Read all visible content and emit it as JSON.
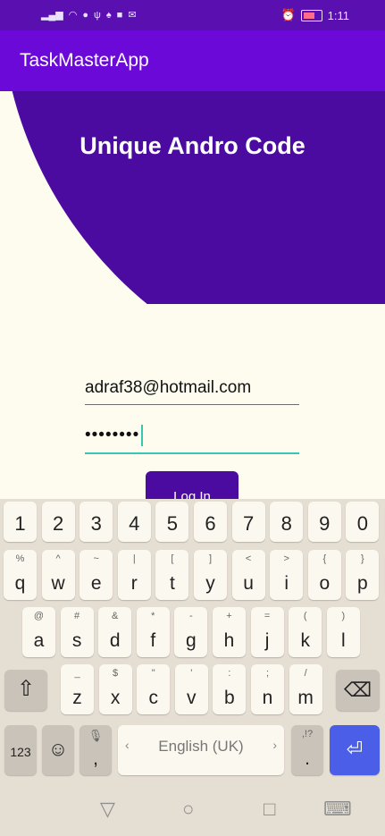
{
  "status": {
    "left_icons": [
      "signal-icon",
      "wifi-icon",
      "notification-icon",
      "usb-icon",
      "snapchat-icon",
      "app-icon",
      "mail-icon"
    ],
    "time": "1:11"
  },
  "app_bar": {
    "title": "TaskMasterApp"
  },
  "header": {
    "title": "Unique Andro Code"
  },
  "form": {
    "email": "adraf38@hotmail.com",
    "password_mask": "••••••••",
    "login_label": "Log In"
  },
  "keyboard": {
    "numbers": [
      "1",
      "2",
      "3",
      "4",
      "5",
      "6",
      "7",
      "8",
      "9",
      "0"
    ],
    "row1": [
      {
        "main": "q",
        "hint": "%"
      },
      {
        "main": "w",
        "hint": "^"
      },
      {
        "main": "e",
        "hint": "~"
      },
      {
        "main": "r",
        "hint": "|"
      },
      {
        "main": "t",
        "hint": "["
      },
      {
        "main": "y",
        "hint": "]"
      },
      {
        "main": "u",
        "hint": "<"
      },
      {
        "main": "i",
        "hint": ">"
      },
      {
        "main": "o",
        "hint": "{"
      },
      {
        "main": "p",
        "hint": "}"
      }
    ],
    "row2": [
      {
        "main": "a",
        "hint": "@"
      },
      {
        "main": "s",
        "hint": "#"
      },
      {
        "main": "d",
        "hint": "&"
      },
      {
        "main": "f",
        "hint": "*"
      },
      {
        "main": "g",
        "hint": "-"
      },
      {
        "main": "h",
        "hint": "+"
      },
      {
        "main": "j",
        "hint": "="
      },
      {
        "main": "k",
        "hint": "("
      },
      {
        "main": "l",
        "hint": ")"
      }
    ],
    "row3": [
      {
        "main": "z",
        "hint": "_"
      },
      {
        "main": "x",
        "hint": "$"
      },
      {
        "main": "c",
        "hint": "\""
      },
      {
        "main": "v",
        "hint": "'"
      },
      {
        "main": "b",
        "hint": ":"
      },
      {
        "main": "n",
        "hint": ";"
      },
      {
        "main": "m",
        "hint": "/"
      }
    ],
    "symbols_label": "123",
    "emoji_glyph": "☺",
    "comma_label": ",",
    "comma_hint": "🎙",
    "space_label": "English (UK)",
    "space_left": "‹",
    "space_right": "›",
    "period_label": ".",
    "period_hint": ",!?",
    "shift_glyph": "⇧",
    "backspace_glyph": "⌫",
    "enter_glyph": "⏎"
  },
  "navbar": {
    "back_glyph": "▽",
    "home_glyph": "○",
    "recents_glyph": "□",
    "keyboard_glyph": "⌨"
  },
  "colors": {
    "status_bar": "#5a0fb0",
    "app_bar": "#6b0ad8",
    "header": "#4c0ba0",
    "accent": "#35c7b0",
    "enter_key": "#4a5ee8"
  }
}
